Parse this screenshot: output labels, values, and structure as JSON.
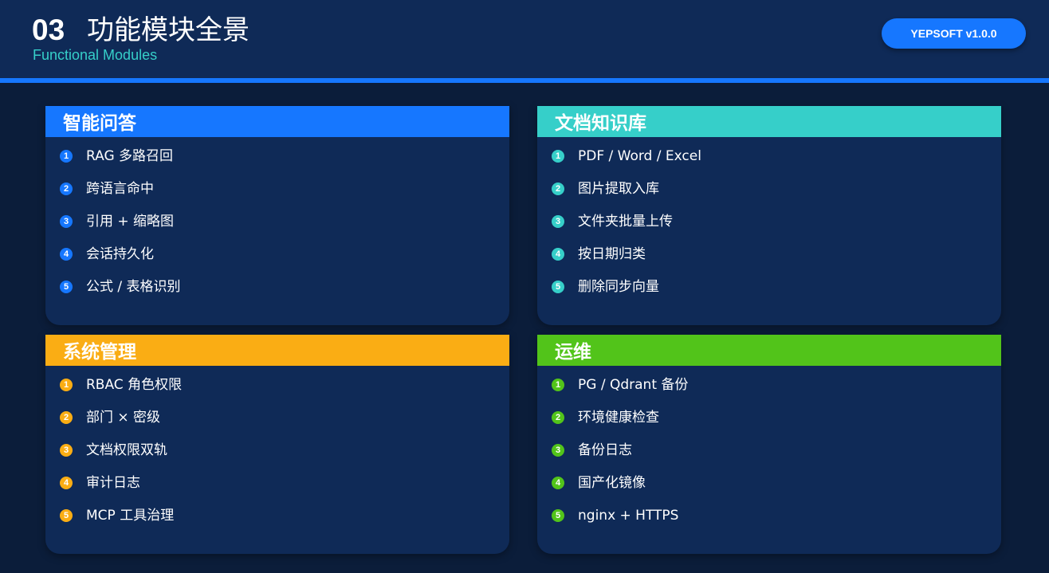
{
  "header": {
    "section_number": "03",
    "title": "功能模块全景",
    "subtitle": "Functional Modules",
    "version_badge": "YEPSOFT v1.0.0"
  },
  "colors": {
    "background": "#0b1d3a",
    "header": "#0f2a57",
    "card": "#0f2a57",
    "accent_blue": "#1677ff",
    "accent_teal": "#36cfc9",
    "accent_orange": "#faad14",
    "accent_green": "#52c41a"
  },
  "modules": [
    {
      "title": "智能问答",
      "color": "#1677ff",
      "items": [
        {
          "num": "1",
          "label": "RAG 多路召回"
        },
        {
          "num": "2",
          "label": "跨语言命中"
        },
        {
          "num": "3",
          "label": "引用 + 缩略图"
        },
        {
          "num": "4",
          "label": "会话持久化"
        },
        {
          "num": "5",
          "label": "公式 / 表格识别"
        }
      ]
    },
    {
      "title": "文档知识库",
      "color": "#36cfc9",
      "items": [
        {
          "num": "1",
          "label": "PDF / Word / Excel"
        },
        {
          "num": "2",
          "label": "图片提取入库"
        },
        {
          "num": "3",
          "label": "文件夹批量上传"
        },
        {
          "num": "4",
          "label": "按日期归类"
        },
        {
          "num": "5",
          "label": "删除同步向量"
        }
      ]
    },
    {
      "title": "系统管理",
      "color": "#faad14",
      "items": [
        {
          "num": "1",
          "label": "RBAC 角色权限"
        },
        {
          "num": "2",
          "label": "部门 × 密级"
        },
        {
          "num": "3",
          "label": "文档权限双轨"
        },
        {
          "num": "4",
          "label": "审计日志"
        },
        {
          "num": "5",
          "label": "MCP 工具治理"
        }
      ]
    },
    {
      "title": "运维",
      "color": "#52c41a",
      "items": [
        {
          "num": "1",
          "label": "PG / Qdrant 备份"
        },
        {
          "num": "2",
          "label": "环境健康检查"
        },
        {
          "num": "3",
          "label": "备份日志"
        },
        {
          "num": "4",
          "label": "国产化镜像"
        },
        {
          "num": "5",
          "label": "nginx + HTTPS"
        }
      ]
    }
  ]
}
